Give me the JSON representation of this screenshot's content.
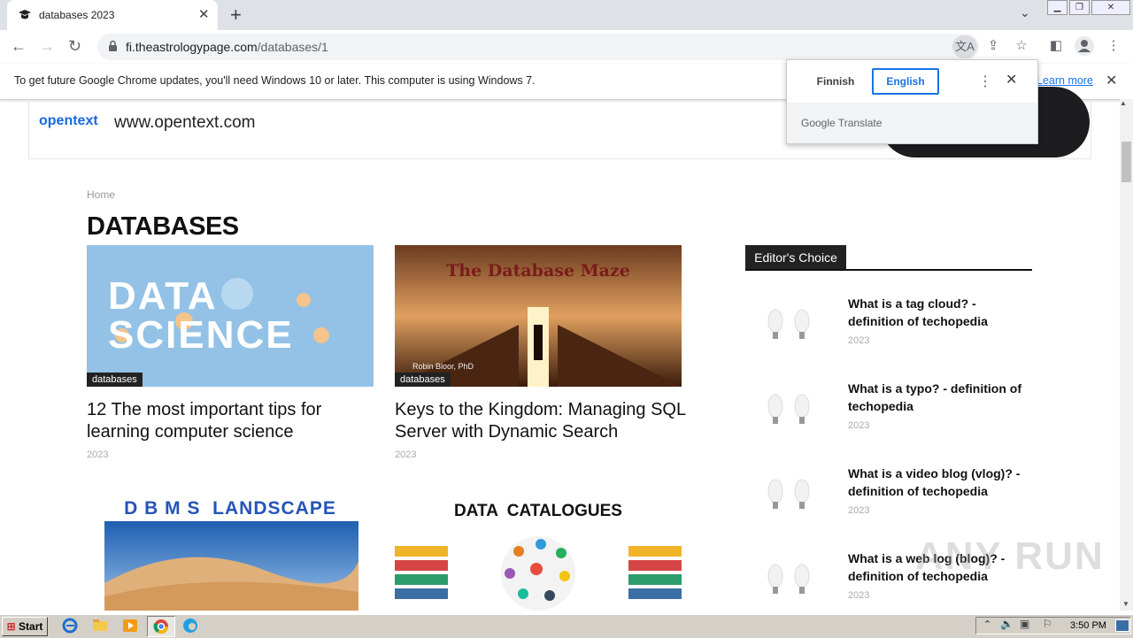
{
  "browser": {
    "tab_title": "databases 2023",
    "url_host": "fi.theastrologypage.com",
    "url_path": "/databases/1"
  },
  "infobar": {
    "message": "To get future Google Chrome updates, you'll need Windows 10 or later. This computer is using Windows 7.",
    "learn_more": "Learn more"
  },
  "translate": {
    "source_lang": "Finnish",
    "target_lang": "English",
    "brand": "Google Translate"
  },
  "ad": {
    "logo": "opentext",
    "url": "www.opentext.com"
  },
  "page": {
    "breadcrumb": "Home",
    "heading": "DATABASES"
  },
  "posts": [
    {
      "title": "12 The most important tips for learning computer science",
      "category": "databases",
      "year": "2023",
      "image_text": "DATA SCIENCE"
    },
    {
      "title": "Keys to the Kingdom: Managing SQL Server with Dynamic Search",
      "category": "databases",
      "year": "2023",
      "image_text": "The Database Maze",
      "image_caption": "Robin Bloor, PhD"
    },
    {
      "title": "",
      "image_text": "D B M S  LANDSCAPE"
    },
    {
      "title": "",
      "image_text": "DATA  CATALOGUES"
    }
  ],
  "editors_choice": {
    "label": "Editor's Choice",
    "items": [
      {
        "title": "What is a tag cloud? - definition of techopedia",
        "year": "2023"
      },
      {
        "title": "What is a typo? - definition of techopedia",
        "year": "2023"
      },
      {
        "title": "What is a video blog (vlog)? - definition of techopedia",
        "year": "2023"
      },
      {
        "title": "What is a web log (blog)? - definition of techopedia",
        "year": "2023"
      }
    ]
  },
  "watermark": "ANY RUN",
  "taskbar": {
    "start": "Start",
    "clock": "3:50 PM"
  },
  "colors": {
    "accent_blue": "#1a73e8",
    "chrome_frame": "#dee1e6",
    "taskbar": "#d4d0c8"
  }
}
